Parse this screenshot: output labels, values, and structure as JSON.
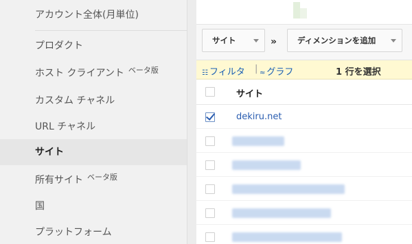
{
  "sidebar": {
    "items": [
      {
        "label": "アカウント全体(月単位)",
        "beta": ""
      },
      {
        "label": "プロダクト",
        "beta": ""
      },
      {
        "label": "ホスト クライアント",
        "beta": "ベータ版"
      },
      {
        "label": "カスタム チャネル",
        "beta": ""
      },
      {
        "label": "URL チャネル",
        "beta": ""
      },
      {
        "label": "サイト",
        "beta": ""
      },
      {
        "label": "所有サイト",
        "beta": "ベータ版"
      },
      {
        "label": "国",
        "beta": ""
      },
      {
        "label": "プラットフォーム",
        "beta": ""
      }
    ],
    "selected_index": 5
  },
  "dimensions": {
    "primary": "サイト",
    "separator": "»",
    "add_label": "ディメンションを追加"
  },
  "filter_bar": {
    "filter_label": "フィルタ",
    "separator": "|",
    "graph_label": "グラフ",
    "selection_text": "1 行を選択"
  },
  "table": {
    "header": "サイト",
    "rows": [
      {
        "site": "dekiru.net",
        "checked": true
      },
      {
        "site": "",
        "checked": false
      },
      {
        "site": "",
        "checked": false
      },
      {
        "site": "",
        "checked": false
      },
      {
        "site": "",
        "checked": false
      },
      {
        "site": "",
        "checked": false
      }
    ]
  },
  "colors": {
    "link": "#2a5db0",
    "filter_bar_bg": "#fff9d2",
    "sidebar_bg": "#f1f1f1"
  }
}
